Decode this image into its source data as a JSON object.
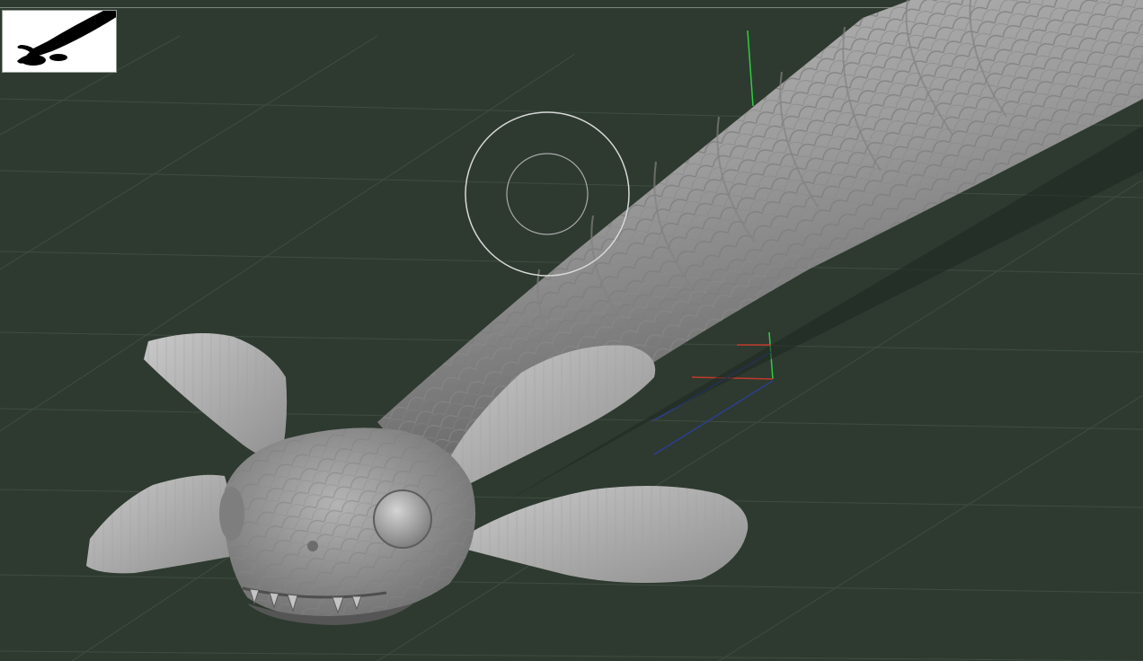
{
  "window": {
    "title": ""
  },
  "viewport": {
    "background_color": "#2e3a30",
    "grid_color": "#3d4d40",
    "model_color": "#9a9a9a",
    "axis_colors": {
      "x": "#c0392b",
      "y": "#2ecc40",
      "z": "#2b3f8f"
    }
  },
  "navigator": {
    "icon": "model-silhouette-icon",
    "background": "#ffffff",
    "silhouette_color": "#000000"
  },
  "brush_cursor": {
    "icon": "brush-cursor-icon",
    "color": "#d8d8d8"
  },
  "gizmo": {
    "icon": "transpose-axis-icon"
  }
}
